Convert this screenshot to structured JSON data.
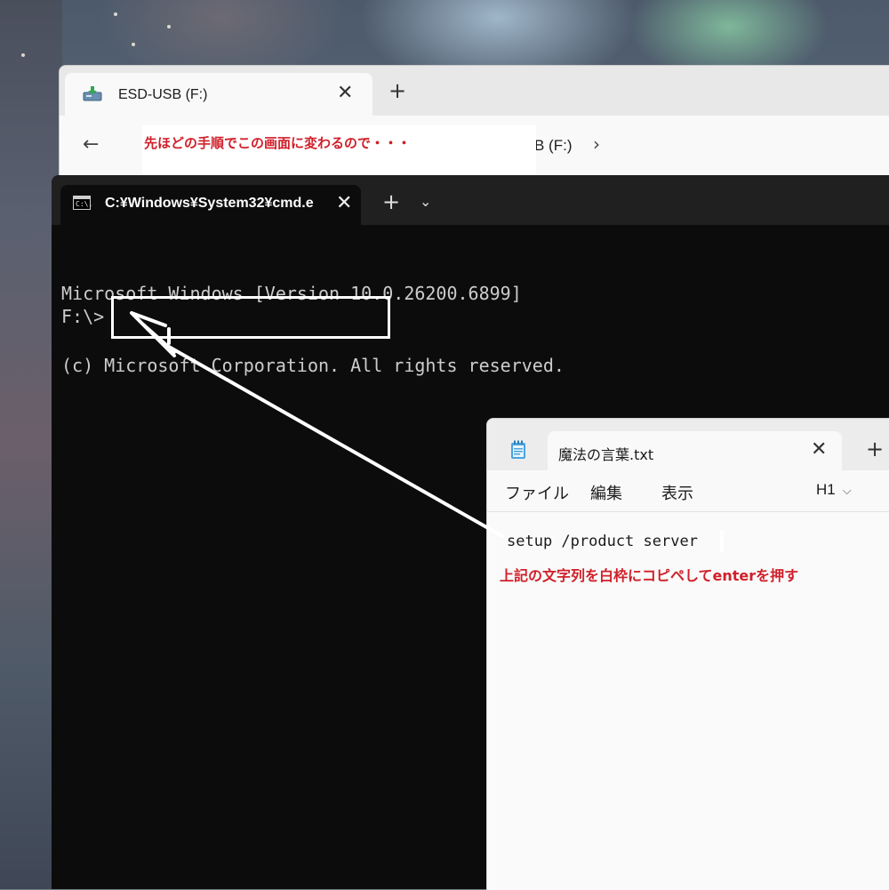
{
  "explorer": {
    "tab_title": "ESD-USB (F:)",
    "tab_close": "✕",
    "new_tab": "+",
    "back": "←",
    "breadcrumb_fragment": "B (F:)",
    "breadcrumb_chevron": "›",
    "drive_icon": "usb-drive-icon"
  },
  "annotation_top": {
    "text": "先ほどの手順でこの画面に変わるので・・・"
  },
  "terminal": {
    "tab_title": "C:¥Windows¥System32¥cmd.e",
    "tab_close": "✕",
    "new_tab": "+",
    "dropdown": "⌄",
    "icon_text": "C:\\.",
    "lines": [
      "Microsoft Windows [Version 10.0.26200.6899]",
      "(c) Microsoft Corporation. All rights reserved."
    ],
    "prompt": "F:\\>"
  },
  "notepad": {
    "tab_title": "魔法の言葉.txt",
    "tab_close": "✕",
    "new_tab": "+",
    "menu": {
      "file": "ファイル",
      "edit": "編集",
      "view": "表示"
    },
    "heading_select": "H1",
    "heading_chevron": "⌵",
    "more": "⋮",
    "content_line": "setup /product server",
    "annotation": "上記の文字列を白枠にコピペしてenterを押す"
  },
  "colors": {
    "annotation_red": "#d0202a",
    "terminal_bg": "#0c0c0c",
    "terminal_text": "#cccccc"
  }
}
